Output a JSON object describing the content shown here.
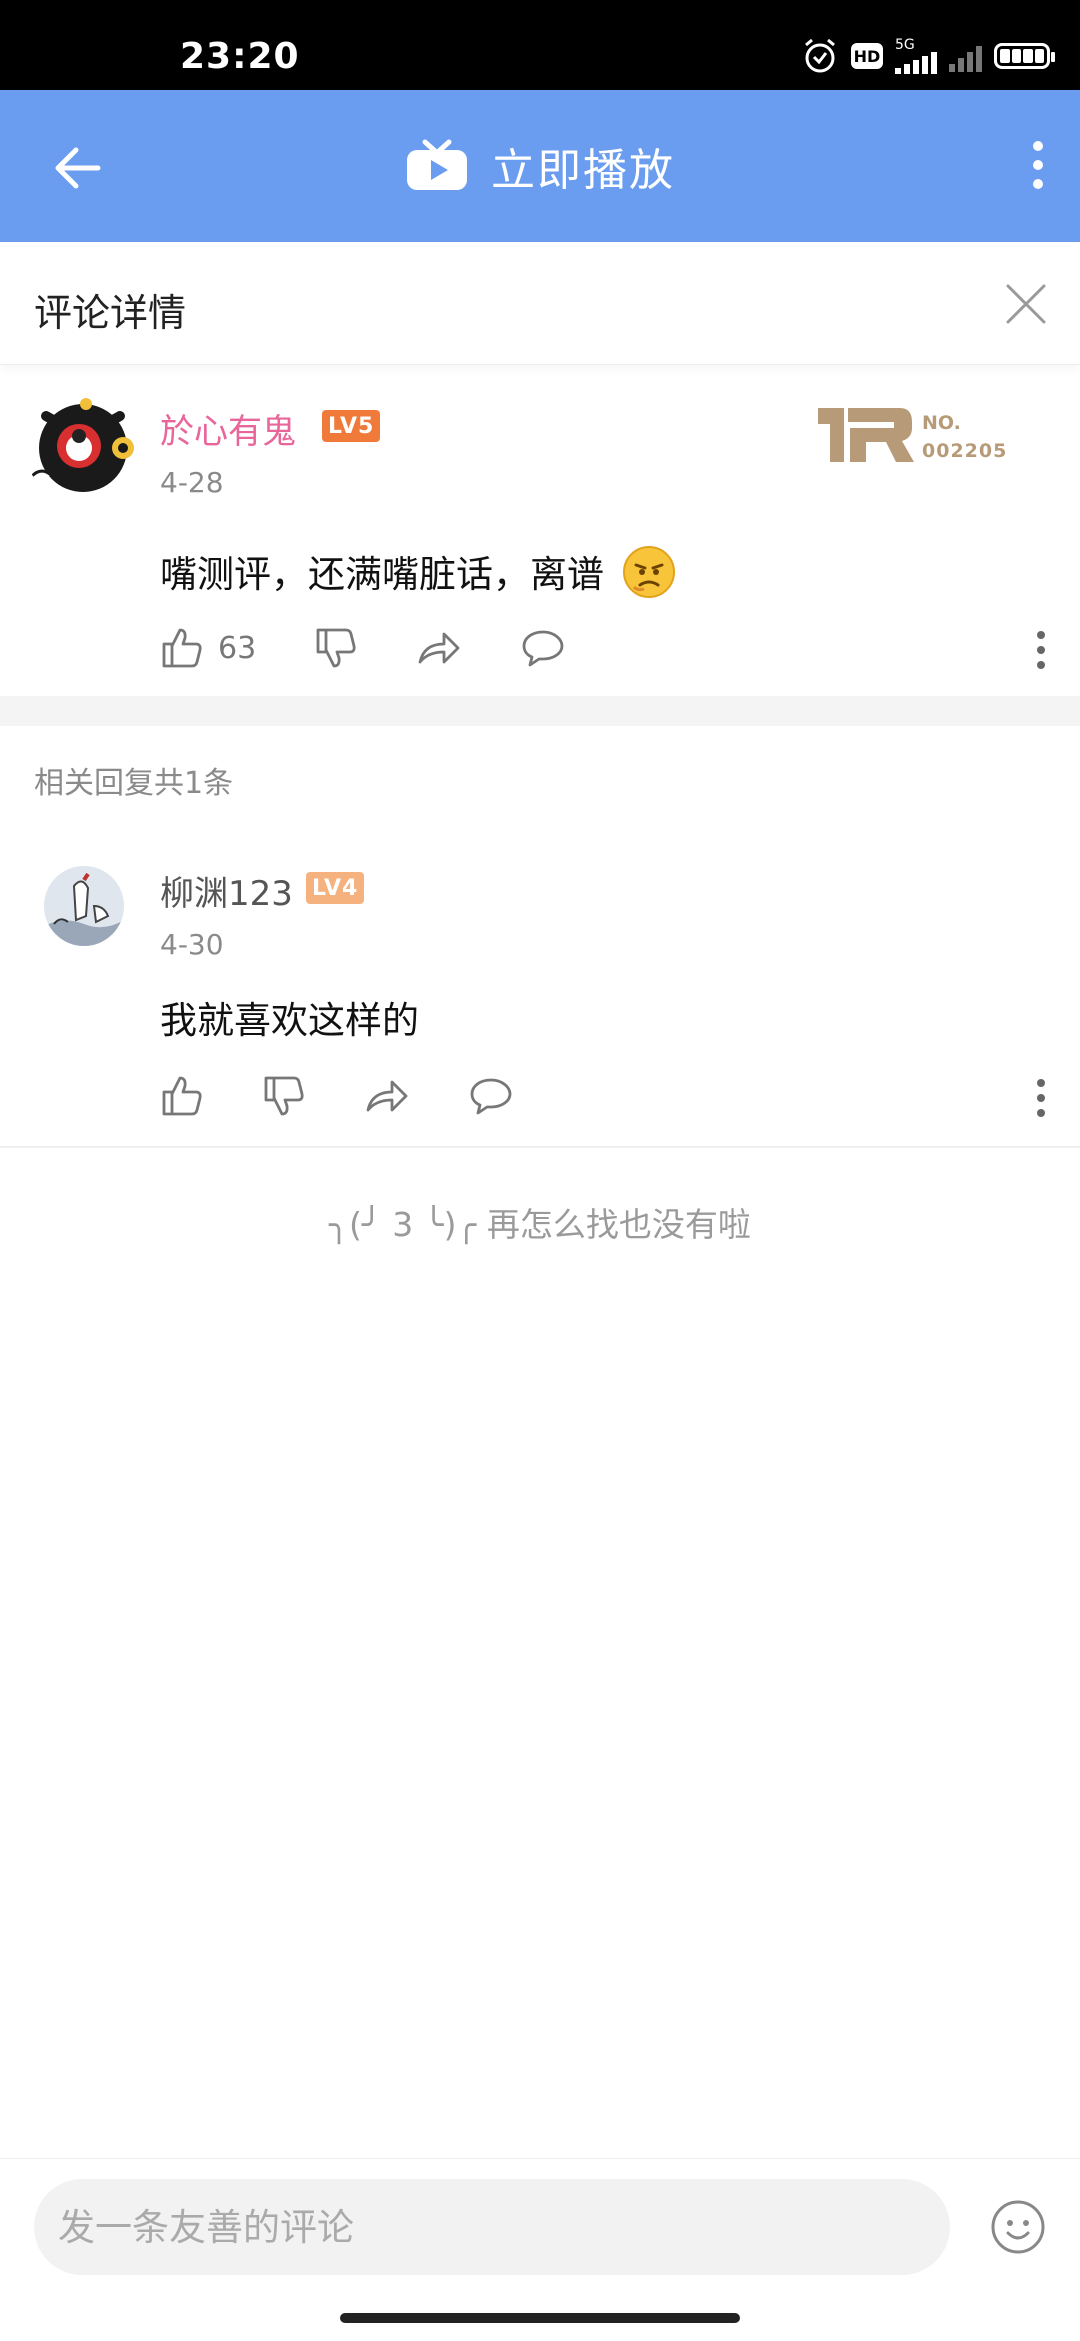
{
  "status_bar": {
    "time": "23:20",
    "hd": "HD",
    "network": "5G"
  },
  "header": {
    "title": "立即播放"
  },
  "sub_header": {
    "title": "评论详情"
  },
  "main_comment": {
    "username": "於心有鬼",
    "level": "LV5",
    "date": "4-28",
    "text": "嘴测评，还满嘴脏话，离谱",
    "likes": "63",
    "badge_line1": "NO.",
    "badge_line2": "002205"
  },
  "replies_header": "相关回复共1条",
  "replies": [
    {
      "username": "柳渊123",
      "level": "LV4",
      "date": "4-30",
      "text": "我就喜欢这样的"
    }
  ],
  "end_message": "╮(╯ 3 ╰)╭ 再怎么找也没有啦",
  "comment_input": {
    "placeholder": "发一条友善的评论"
  },
  "colors": {
    "header_bg": "#6a9cf0",
    "username_pink": "#e8669a",
    "lv5": "#f07a3a",
    "lv4": "#f5b27e",
    "badge": "#b79b78"
  }
}
